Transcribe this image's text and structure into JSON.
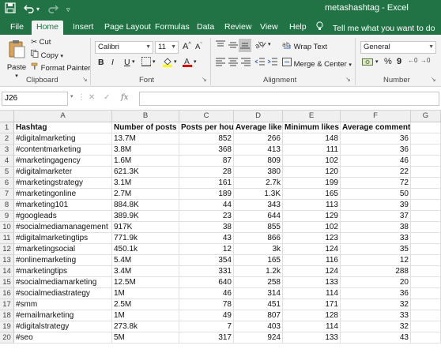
{
  "window": {
    "title": "metashashtag  -  Excel"
  },
  "ribbon_tabs": [
    "File",
    "Home",
    "Insert",
    "Page Layout",
    "Formulas",
    "Data",
    "Review",
    "View",
    "Help"
  ],
  "tell_me": "Tell me what you want to do",
  "clipboard": {
    "paste": "Paste",
    "cut": "Cut",
    "copy": "Copy",
    "format_painter": "Format Painter",
    "label": "Clipboard"
  },
  "font": {
    "name": "Calibri",
    "size": "11",
    "bold": "B",
    "italic": "I",
    "underline": "U",
    "grow": "A",
    "shrink": "A",
    "label": "Font"
  },
  "alignment": {
    "wrap_text": "Wrap Text",
    "merge_center": "Merge & Center",
    "label": "Alignment"
  },
  "number": {
    "format": "General",
    "percent": "%",
    "comma": "9",
    "label": "Number"
  },
  "name_box": "J26",
  "formula_bar": {
    "cancel": "✕",
    "enter": "✓",
    "fx": "fx"
  },
  "columns": [
    "A",
    "B",
    "C",
    "D",
    "E",
    "F",
    "G"
  ],
  "rows": [
    [
      "Hashtag",
      "Number of posts",
      "Posts per hour",
      "Average likes",
      "Minimum likes",
      "Average comments",
      ""
    ],
    [
      "#digitalmarketing",
      "13.7M",
      "852",
      "266",
      "148",
      "36",
      ""
    ],
    [
      "#contentmarketing",
      "3.8M",
      "368",
      "413",
      "111",
      "36",
      ""
    ],
    [
      "#marketingagency",
      "1.6M",
      "87",
      "809",
      "102",
      "46",
      ""
    ],
    [
      "#digitalmarketer",
      "621.3K",
      "28",
      "380",
      "120",
      "22",
      ""
    ],
    [
      "#marketingstrategy",
      "3.1M",
      "161",
      "2.7k",
      "199",
      "72",
      ""
    ],
    [
      "#marketingonline",
      "2.7M",
      "189",
      "1.3K",
      "165",
      "50",
      ""
    ],
    [
      "#marketing101",
      "884.8K",
      "44",
      "343",
      "113",
      "39",
      ""
    ],
    [
      "#googleads",
      "389.9K",
      "23",
      "644",
      "129",
      "37",
      ""
    ],
    [
      "#socialmediamanagement",
      "917K",
      "38",
      "855",
      "102",
      "38",
      ""
    ],
    [
      "#digitalmarketingtips",
      "771.9k",
      "43",
      "866",
      "123",
      "33",
      ""
    ],
    [
      "#marketingsocial",
      "450.1k",
      "12",
      "3k",
      "124",
      "35",
      ""
    ],
    [
      "#onlinemarketing",
      "5.4M",
      "354",
      "165",
      "116",
      "12",
      ""
    ],
    [
      "#marketingtips",
      "3.4M",
      "331",
      "1.2k",
      "124",
      "288",
      ""
    ],
    [
      "#socialmediamarketing",
      "12.5M",
      "640",
      "258",
      "133",
      "20",
      ""
    ],
    [
      "#socialmediastrategy",
      "1M",
      "46",
      "314",
      "114",
      "36",
      ""
    ],
    [
      "#smm",
      "2.5M",
      "78",
      "451",
      "171",
      "32",
      ""
    ],
    [
      "#emailmarketing",
      "1M",
      "49",
      "807",
      "128",
      "33",
      ""
    ],
    [
      "#digitalstrategy",
      "273.8k",
      "7",
      "403",
      "114",
      "32",
      ""
    ],
    [
      "#seo",
      "5M",
      "317",
      "924",
      "133",
      "43",
      ""
    ]
  ]
}
